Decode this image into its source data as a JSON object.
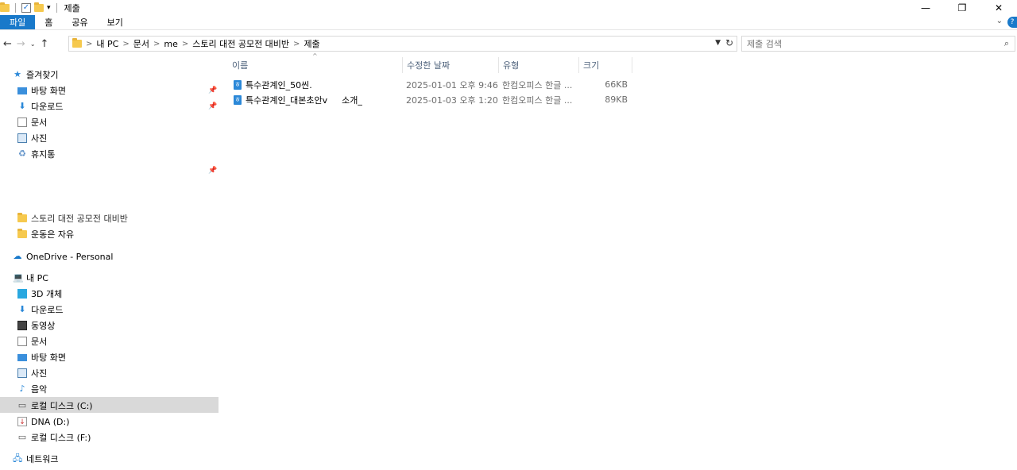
{
  "window": {
    "title": "제출"
  },
  "ribbon": {
    "tabs": [
      {
        "label": "파일",
        "active": true
      },
      {
        "label": "홈"
      },
      {
        "label": "공유"
      },
      {
        "label": "보기"
      }
    ]
  },
  "address": {
    "crumbs": [
      "내 PC",
      "문서",
      "me",
      "스토리 대전 공모전 대비반",
      "제출"
    ]
  },
  "search": {
    "placeholder": "제출 검색"
  },
  "sidebar": {
    "quick_access": "즐겨찾기",
    "pinned": [
      "바탕 화면",
      "다운로드",
      "문서",
      "사진",
      "휴지통"
    ],
    "recent": [
      "스토리 대전 공모전 대비반",
      "운동은 자유"
    ],
    "onedrive": "OneDrive - Personal",
    "this_pc": "내 PC",
    "pc_items": [
      "3D 개체",
      "다운로드",
      "동영상",
      "문서",
      "바탕 화면",
      "사진",
      "음악",
      "로컬 디스크 (C:)",
      "DNA (D:)",
      "로컬 디스크 (F:)"
    ],
    "network": "네트워크"
  },
  "columns": {
    "name": "이름",
    "modified": "수정한 날짜",
    "type": "유형",
    "size": "크기"
  },
  "files": [
    {
      "name": "특수관계인_50씬.",
      "modified": "2025-01-01 오후 9:46",
      "type": "한컴오피스 한글 ...",
      "size": "66KB"
    },
    {
      "name": "특수관계인_대본초안v",
      "name_tail": "소개_",
      "modified": "2025-01-03 오후 1:20",
      "type": "한컴오피스 한글 ...",
      "size": "89KB"
    }
  ],
  "colors": {
    "accent": "#1979ca",
    "selection": "#d9d9d9",
    "header_text": "#4c607a"
  },
  "icons": {
    "star": "star-icon",
    "pin": "pin-icon",
    "folder": "folder-icon",
    "hwp": "hwp-file-icon"
  }
}
